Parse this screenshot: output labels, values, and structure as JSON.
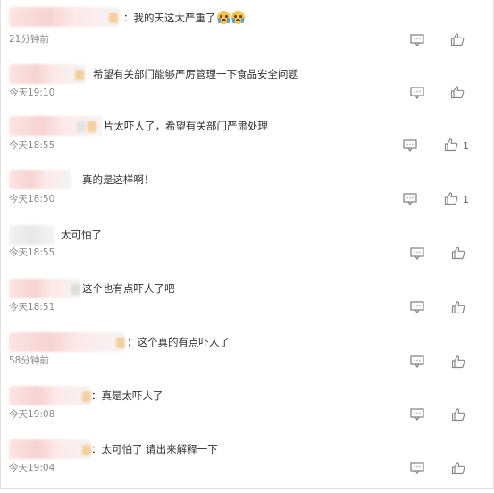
{
  "comments": [
    {
      "text": "：我的天这太严重了",
      "emojis": [
        "crying-face-icon",
        "crying-face-icon"
      ],
      "time": "21分钟前",
      "likes": ""
    },
    {
      "text": "希望有关部门能够严厉管理一下食品安全问题",
      "emojis": [],
      "time": "今天19:10",
      "likes": ""
    },
    {
      "text": "片太吓人了，希望有关部门严肃处理",
      "emojis": [],
      "time": "今天18:55",
      "likes": "1"
    },
    {
      "text": "真的是这样啊！",
      "emojis": [],
      "time": "今天18:50",
      "likes": "1"
    },
    {
      "text": "太可怕了",
      "emojis": [],
      "time": "今天18:55",
      "likes": ""
    },
    {
      "text": "这个也有点吓人了吧",
      "emojis": [],
      "time": "今天18:51",
      "likes": ""
    },
    {
      "text": "：这个真的有点吓人了",
      "emojis": [],
      "time": "58分钟前",
      "likes": ""
    },
    {
      "text": "：真是太吓人了",
      "emojis": [],
      "time": "今天19:08",
      "likes": ""
    },
    {
      "text": "：太可怕了 请出来解释一下",
      "emojis": [],
      "time": "今天19:04",
      "likes": ""
    }
  ],
  "icons": {
    "reply": "comment-reply-icon",
    "like": "thumbs-up-icon"
  },
  "colors": {
    "text": "#333333",
    "time": "#8a8a8a",
    "icon": "#888888"
  }
}
